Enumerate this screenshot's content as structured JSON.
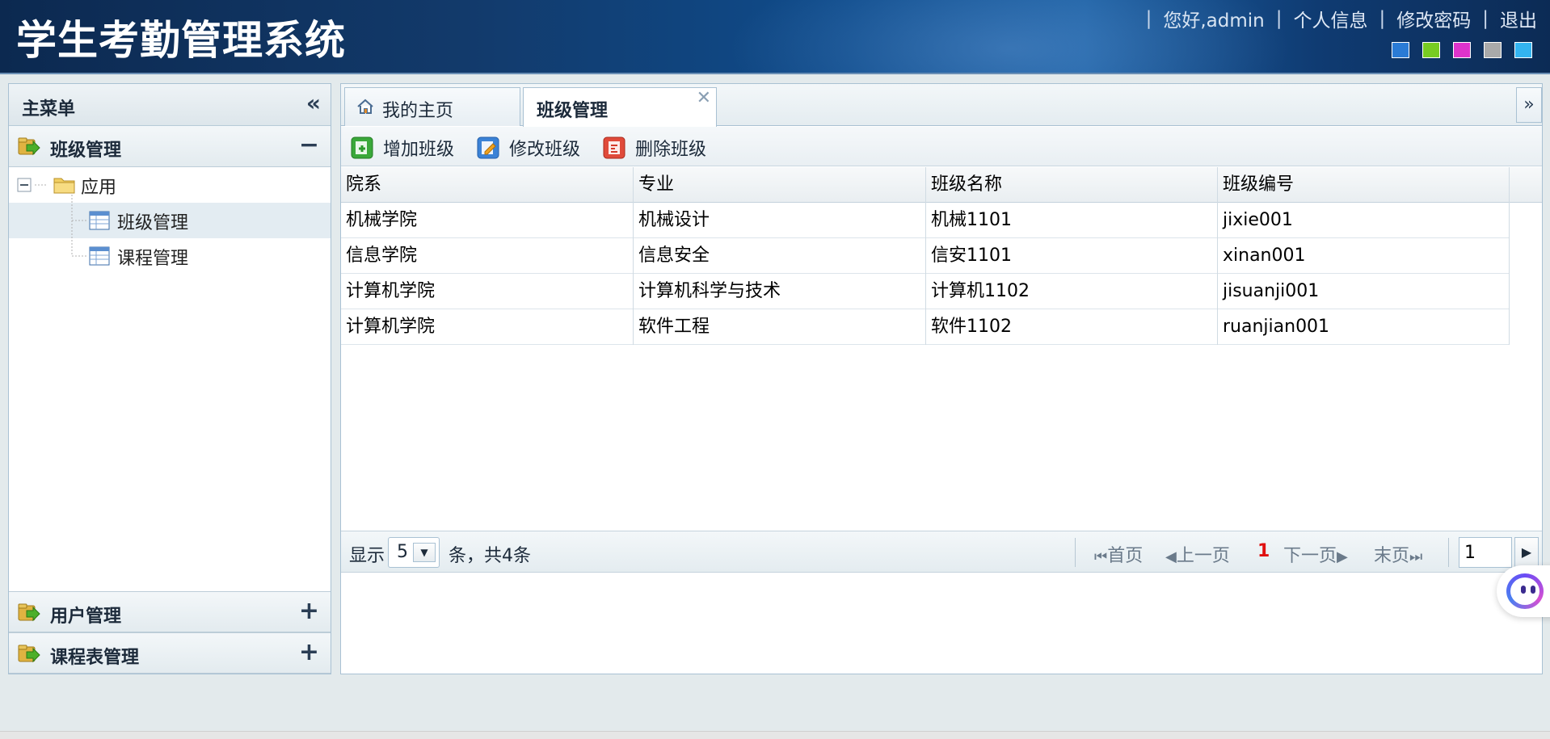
{
  "header": {
    "app_title": "学生考勤管理系统",
    "greeting": "您好,admin",
    "links": [
      "个人信息",
      "修改密码",
      "退出"
    ],
    "theme_colors": [
      "#2a7bd6",
      "#77cc22",
      "#dd33cc",
      "#aaaaaa",
      "#33b4f0"
    ]
  },
  "sidebar": {
    "title": "主菜单",
    "sections": [
      {
        "label": "班级管理",
        "toggle": "−",
        "expanded": true
      },
      {
        "label": "用户管理",
        "toggle": "+",
        "expanded": false
      },
      {
        "label": "课程表管理",
        "toggle": "+",
        "expanded": false
      }
    ],
    "tree": {
      "folder": "应用",
      "items": [
        {
          "label": "班级管理",
          "selected": true
        },
        {
          "label": "课程管理",
          "selected": false
        }
      ]
    }
  },
  "tabs": [
    {
      "label": "我的主页",
      "active": false,
      "closable": false
    },
    {
      "label": "班级管理",
      "active": true,
      "closable": true
    }
  ],
  "toolbar": {
    "add_label": "增加班级",
    "edit_label": "修改班级",
    "delete_label": "删除班级"
  },
  "grid": {
    "columns": [
      "院系",
      "专业",
      "班级名称",
      "班级编号"
    ],
    "rows": [
      [
        "机械学院",
        "机械设计",
        "机械1101",
        "jixie001"
      ],
      [
        "信息学院",
        "信息安全",
        "信安1101",
        "xinan001"
      ],
      [
        "计算机学院",
        "计算机科学与技术",
        "计算机1102",
        "jisuanji001"
      ],
      [
        "计算机学院",
        "软件工程",
        "软件1102",
        "ruanjian001"
      ]
    ]
  },
  "pager": {
    "show_label": "显示",
    "page_size": "5",
    "total_label": "条，共4条",
    "first": "首页",
    "prev": "上一页",
    "current_page": "1",
    "next": "下一页",
    "last": "末页",
    "page_input": "1"
  }
}
